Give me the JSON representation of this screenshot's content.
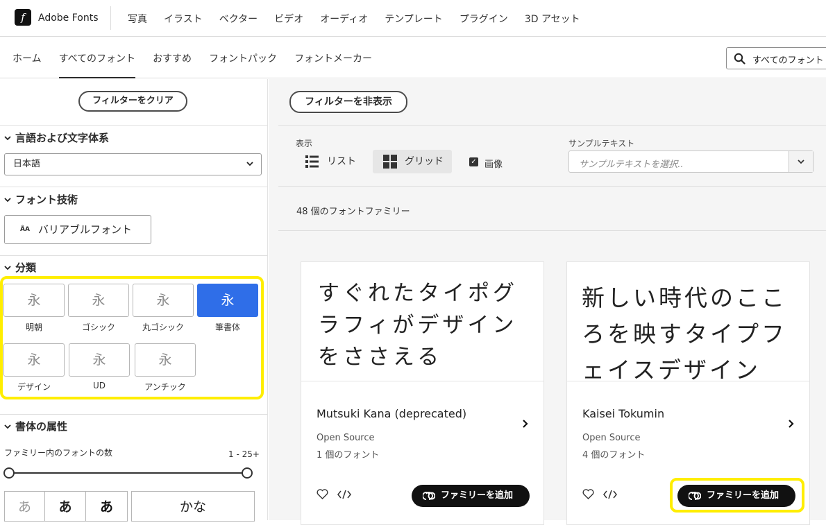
{
  "header": {
    "brand": "Adobe Fonts",
    "categories": [
      "写真",
      "イラスト",
      "ベクター",
      "ビデオ",
      "オーディオ",
      "テンプレート",
      "プラグイン",
      "3D アセット"
    ]
  },
  "subnav": {
    "tabs": [
      "ホーム",
      "すべてのフォント",
      "おすすめ",
      "フォントパック",
      "フォントメーカー"
    ],
    "active_tab": "すべてのフォント",
    "search_text": "すべてのフォント"
  },
  "sidebar": {
    "clear_filters": "フィルターをクリア",
    "language_heading": "言語および文字体系",
    "language_value": "日本語",
    "tech_heading": "フォント技術",
    "variable_button": "バリアブルフォント",
    "classification_heading": "分類",
    "classifications": [
      {
        "label": "明朝",
        "glyph": "永",
        "selected": false
      },
      {
        "label": "ゴシック",
        "glyph": "永",
        "selected": false
      },
      {
        "label": "丸ゴシック",
        "glyph": "永",
        "selected": false
      },
      {
        "label": "筆書体",
        "glyph": "永",
        "selected": true
      },
      {
        "label": "デザイン",
        "glyph": "永",
        "selected": false
      },
      {
        "label": "UD",
        "glyph": "永",
        "selected": false
      },
      {
        "label": "アンチック",
        "glyph": "永",
        "selected": false
      }
    ],
    "properties_heading": "書体の属性",
    "font_count_label": "ファミリー内のフォントの数",
    "font_count_range": "1 - 25+",
    "weights": [
      "あ",
      "あ",
      "あ"
    ],
    "kana_button": "かな"
  },
  "main": {
    "hide_filters": "フィルターを非表示",
    "view_label": "表示",
    "list_label": "リスト",
    "grid_label": "グリッド",
    "image_label": "画像",
    "image_checked": true,
    "sample_label": "サンプルテキスト",
    "sample_placeholder": "サンプルテキストを選択..",
    "result_count": "48 個のフォントファミリー",
    "add_family_label": "ファミリーを追加",
    "cards": [
      {
        "sample_lines": [
          "すぐれたタイポグ",
          "ラフィがデザイン",
          "をささえる"
        ],
        "name": "Mutsuki Kana (deprecated)",
        "source": "Open Source",
        "count": "1 個のフォント"
      },
      {
        "sample_lines": [
          "新しい時代のここ",
          "ろを映すタイプフ",
          "ェイスデザイン"
        ],
        "name": "Kaisei Tokumin",
        "source": "Open Source",
        "count": "4 個のフォント"
      }
    ]
  },
  "colors": {
    "highlight": "#ffee00",
    "selected_class": "#2f6ee8",
    "button_dark": "#111111"
  }
}
